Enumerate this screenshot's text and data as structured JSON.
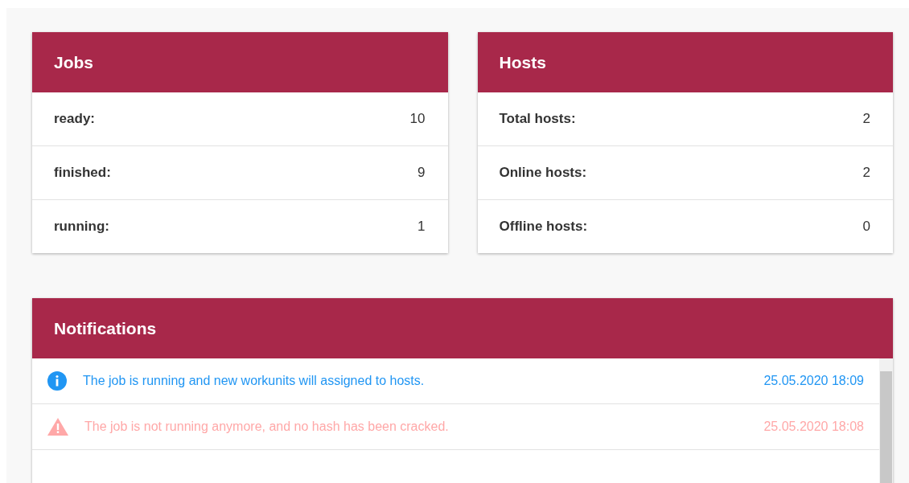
{
  "jobs": {
    "title": "Jobs",
    "rows": [
      {
        "label": "ready:",
        "value": "10"
      },
      {
        "label": "finished:",
        "value": "9"
      },
      {
        "label": "running:",
        "value": "1"
      }
    ]
  },
  "hosts": {
    "title": "Hosts",
    "rows": [
      {
        "label": "Total hosts:",
        "value": "2"
      },
      {
        "label": "Online hosts:",
        "value": "2"
      },
      {
        "label": "Offline hosts:",
        "value": "0"
      }
    ]
  },
  "notifications": {
    "title": "Notifications",
    "items": [
      {
        "kind": "info",
        "message": "The job is running and new workunits will assigned to hosts.",
        "time": "25.05.2020 18:09"
      },
      {
        "kind": "warning",
        "message": "The job is not running anymore, and no hash has been cracked.",
        "time": "25.05.2020 18:08"
      }
    ]
  }
}
